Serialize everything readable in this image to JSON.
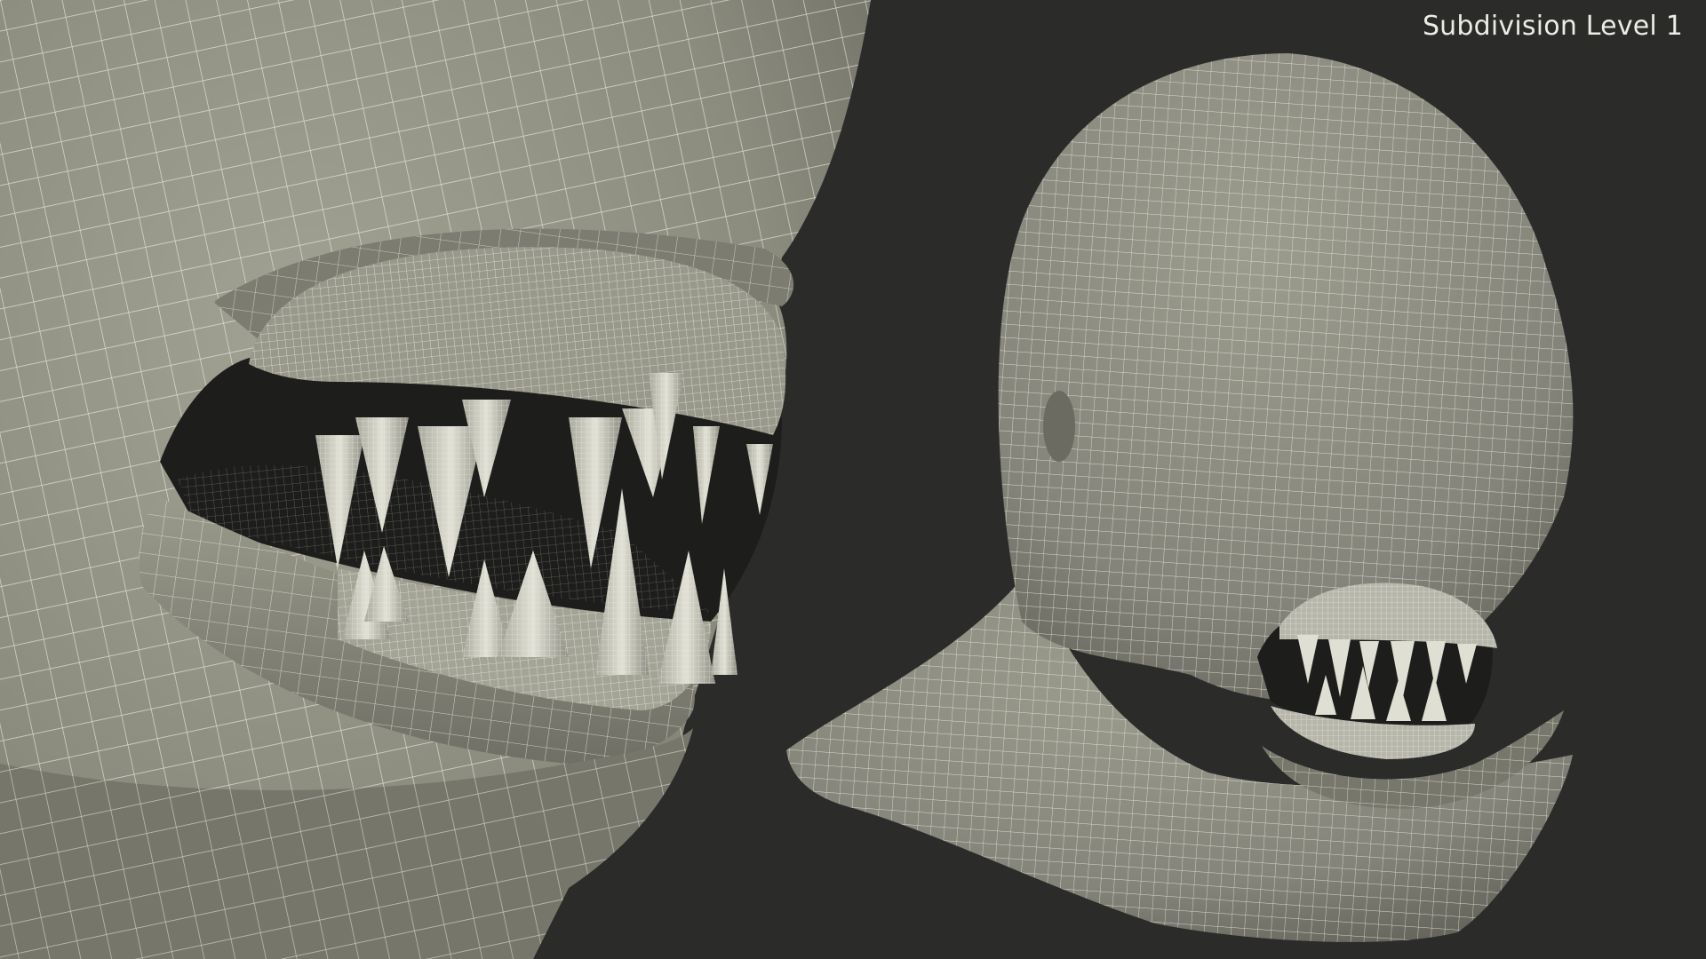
{
  "caption": "Subdivision Level 1",
  "colors": {
    "background": "#2b2b2a",
    "mesh_surface": "#8d8d80",
    "mesh_shadow": "#5f5f56",
    "wireframe": "#e9e8de",
    "teeth": "#d8d7cc",
    "mouth_interior": "#1d1d1b",
    "caption": "#ecebe4"
  },
  "views": [
    {
      "name": "closeup-mouth-view",
      "description_icon": "mesh-closeup"
    },
    {
      "name": "full-head-view",
      "description_icon": "mesh-head"
    }
  ]
}
